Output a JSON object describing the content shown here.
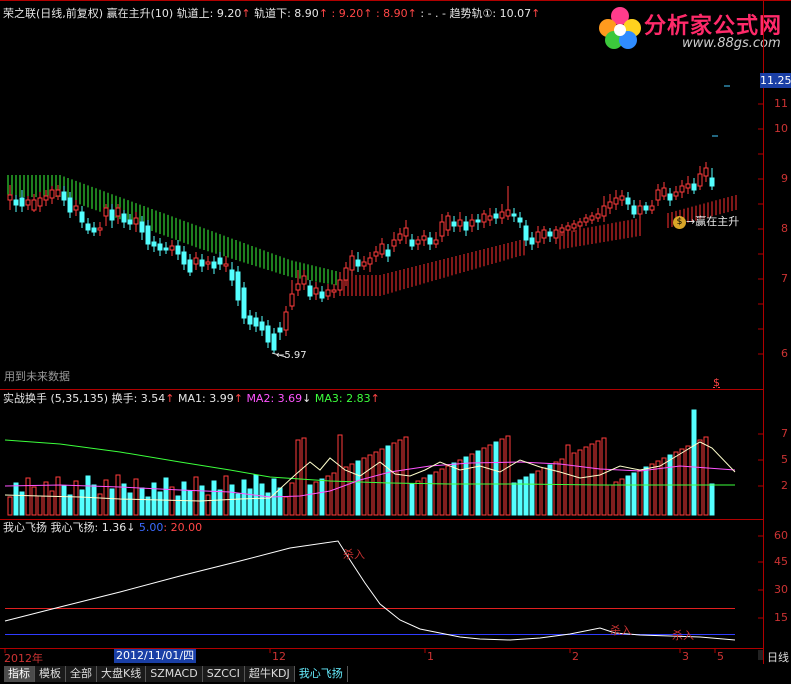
{
  "main_header": {
    "title": "荣之联(日线,前复权)",
    "indicator": "赢在主升(10)",
    "track_up_label": "轨道上: 9.20",
    "track_down_label": "轨道下: 8.90",
    "v1": "9.20",
    "v2": "8.90",
    "dots": ": - . -",
    "trend_label": "趋势轨①: 10.07"
  },
  "logo": {
    "name": "分析家公式网",
    "url": "www.88gs.com"
  },
  "main_chart": {
    "price_axis": [
      "11",
      "10",
      "9",
      "8",
      "7",
      "6"
    ],
    "current_price": "11.25",
    "low_label": "5.97",
    "signal_label": "赢在主升",
    "future_label": "用到未来数据",
    "dollar_mark": "$"
  },
  "volume_panel": {
    "name": "实战换手 (5,35,135)",
    "value_label": "换手: 3.54",
    "ma1": "MA1: 3.99",
    "ma2": "MA2: 3.69",
    "ma3": "MA3: 2.83",
    "axis": [
      "7",
      "5",
      "2"
    ]
  },
  "feiyang_panel": {
    "name": "我心飞扬",
    "value_label": "我心飞扬: 1.36",
    "v5": "5.00",
    "v20": ": 20.00",
    "axis": [
      "60",
      "45",
      "30",
      "15"
    ],
    "annotations": [
      "杀入",
      "杀入",
      "杀入"
    ]
  },
  "date_axis": {
    "year_label": "2012年",
    "cursor_date": "2012/11/01/四",
    "ticks": [
      "12",
      "1",
      "2",
      "3",
      "5"
    ],
    "period": "日线"
  },
  "tabs": [
    "指标",
    "模板",
    "全部",
    "大盘K线",
    "SZMACD",
    "SZCCI",
    "超牛KDJ",
    "我心飞扬"
  ],
  "colors": {
    "up": "#ff3c3c",
    "down": "#54ffff",
    "band_green": "#3cff3c",
    "band_red": "#ff3030",
    "axis": "#b00000"
  }
}
